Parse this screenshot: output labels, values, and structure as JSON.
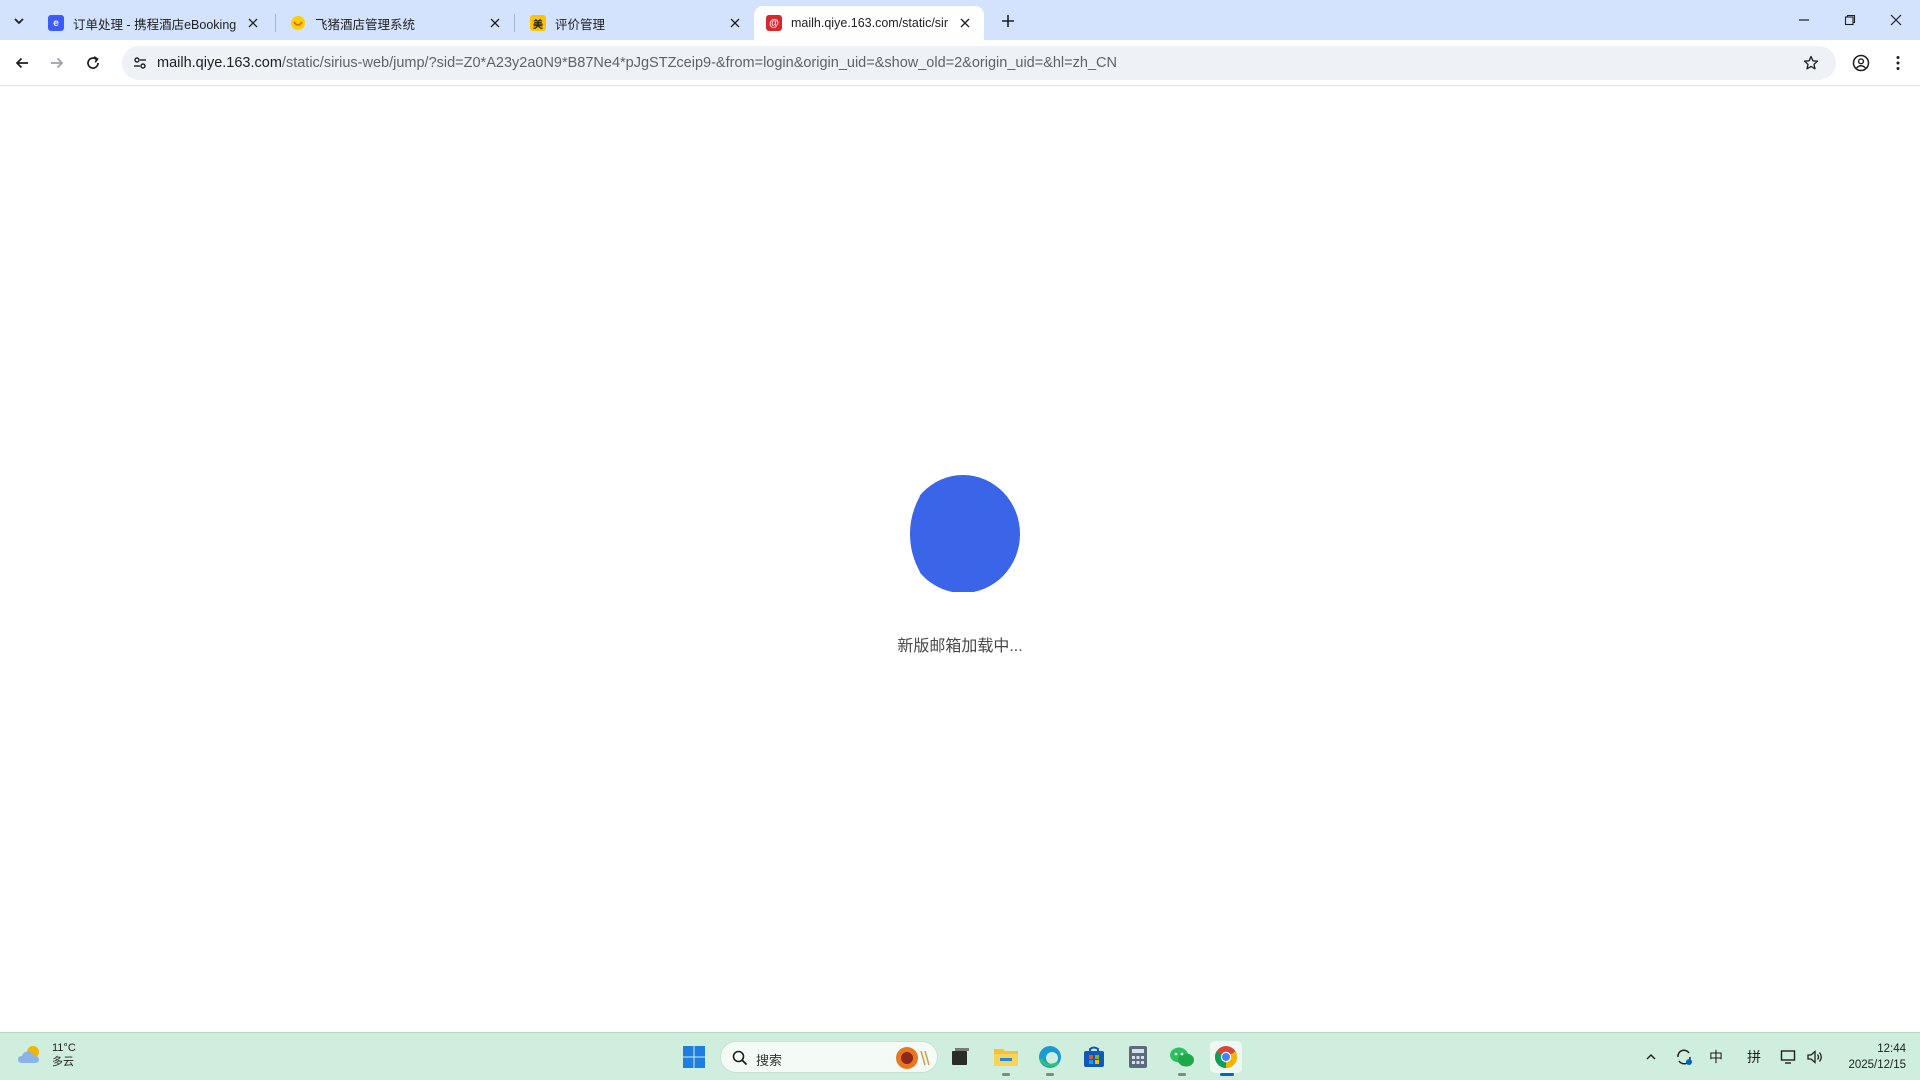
{
  "browser": {
    "tabs": [
      {
        "title": "订单处理 - 携程酒店eBooking",
        "favicon": "ebooking-icon",
        "favicon_char": "e",
        "favicon_color": "#3d5afe"
      },
      {
        "title": "飞猪酒店管理系统",
        "favicon": "fliggy-icon",
        "favicon_char": "",
        "favicon_color": "#ffcf00"
      },
      {
        "title": "评价管理",
        "favicon": "meituan-icon",
        "favicon_char": "美",
        "favicon_color": "#ffc300"
      },
      {
        "title": "mailh.qiye.163.com/static/sir",
        "favicon": "netease-mail-icon",
        "favicon_char": "@",
        "favicon_color": "#d7282f",
        "active": true
      }
    ],
    "url": {
      "host": "mailh.qiye.163.com",
      "path": "/static/sirius-web/jump/?sid=Z0*A23y2a0N9*B87Ne4*pJgSTZceip9-&from=login&origin_uid=&show_old=2&origin_uid=&hl=zh_CN"
    }
  },
  "page": {
    "loading_text": "新版邮箱加载中...",
    "spinner_color": "#3a65e8"
  },
  "taskbar": {
    "weather": {
      "temp": "11°C",
      "condition": "多云"
    },
    "search_placeholder": "搜索",
    "tray": {
      "ime_lang": "中",
      "ime_mode": "拼"
    },
    "clock": {
      "time": "12:44",
      "date": "2025/12/15"
    },
    "accent": "#0067c0"
  }
}
